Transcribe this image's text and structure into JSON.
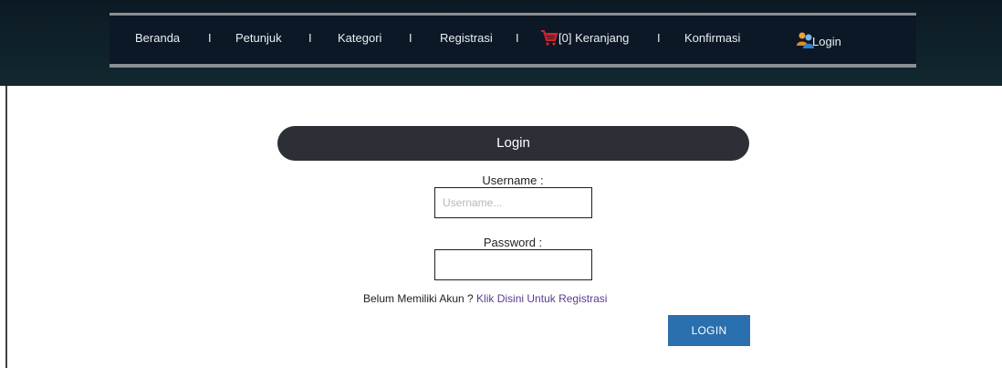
{
  "nav": {
    "beranda": "Beranda",
    "petunjuk": "Petunjuk",
    "kategori": "Kategori",
    "registrasi": "Registrasi",
    "keranjang": "[0] Keranjang",
    "konfirmasi": "Konfirmasi",
    "login": "Login",
    "separator": "I"
  },
  "form": {
    "title": "Login",
    "username_label": "Username :",
    "username_placeholder": "Username...",
    "username_value": "",
    "password_label": "Password :",
    "password_value": "",
    "no_account_text": "Belum Memiliki Akun ? ",
    "register_link": "Klik Disini Untuk Registrasi",
    "submit_label": "LOGIN"
  },
  "colors": {
    "navbar_bg": "#0d1826",
    "title_bar_bg": "#2c3036",
    "button_bg": "#2a6fae",
    "link": "#5b3d8e"
  },
  "icons": {
    "cart": "shopping-cart-icon",
    "login": "users-icon"
  }
}
